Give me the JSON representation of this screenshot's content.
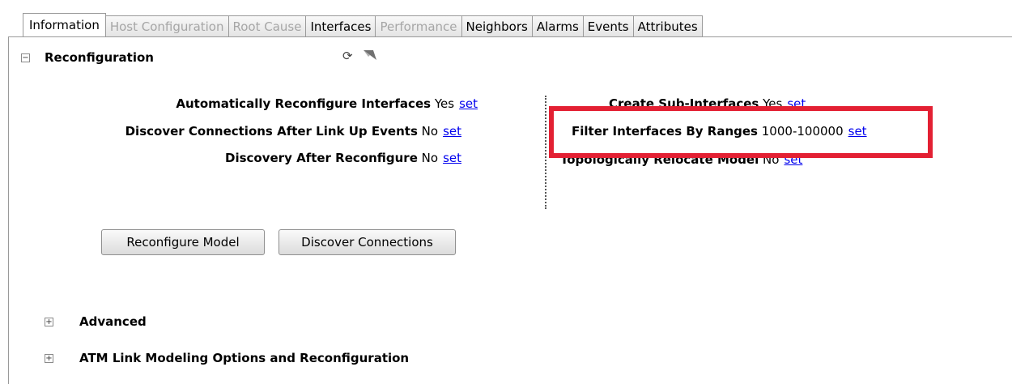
{
  "tabs": [
    {
      "label": "Information",
      "state": "active"
    },
    {
      "label": "Host Configuration",
      "state": "disabled"
    },
    {
      "label": "Root Cause",
      "state": "disabled"
    },
    {
      "label": "Interfaces",
      "state": "normal"
    },
    {
      "label": "Performance",
      "state": "disabled"
    },
    {
      "label": "Neighbors",
      "state": "normal"
    },
    {
      "label": "Alarms",
      "state": "normal"
    },
    {
      "label": "Events",
      "state": "normal"
    },
    {
      "label": "Attributes",
      "state": "normal"
    }
  ],
  "reconfiguration": {
    "title": "Reconfiguration",
    "left": [
      {
        "label": "Automatically Reconfigure Interfaces",
        "value": "Yes",
        "link": "set"
      },
      {
        "label": "Discover Connections After Link Up Events",
        "value": "No",
        "link": "set"
      },
      {
        "label": "Discovery After Reconfigure",
        "value": "No",
        "link": "set"
      }
    ],
    "right": [
      {
        "label": "Create Sub-Interfaces",
        "value": "Yes",
        "link": "set"
      },
      {
        "label": "Filter Interfaces By Ranges",
        "value": "1000-100000",
        "link": "set"
      },
      {
        "label": "Topologically Relocate Model",
        "value": "No",
        "link": "set"
      }
    ],
    "buttons": {
      "reconfigure": "Reconfigure Model",
      "discover": "Discover Connections"
    }
  },
  "sections": {
    "advanced": "Advanced",
    "atm": "ATM Link Modeling Options and Reconfiguration"
  },
  "colors": {
    "highlight": "#e32033",
    "link": "#0000ee"
  },
  "icons": {
    "refresh": "refresh-icon",
    "pin": "pin-icon"
  }
}
